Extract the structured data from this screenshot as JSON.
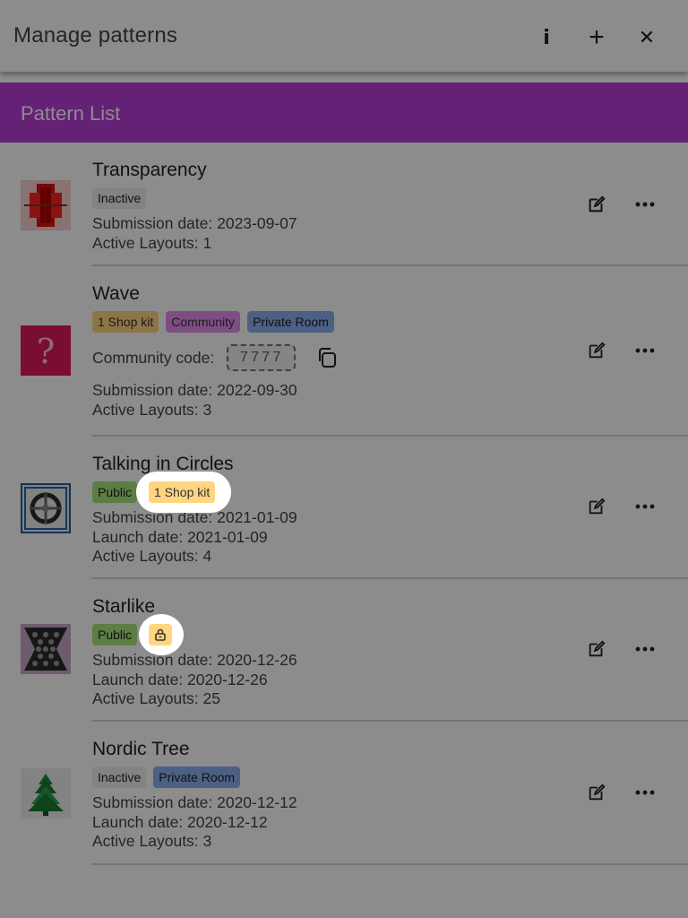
{
  "header": {
    "title": "Manage patterns",
    "actions": {
      "info_label": "i",
      "add_label": "+",
      "close_label": "✕"
    }
  },
  "section": {
    "title": "Pattern List"
  },
  "patterns": [
    {
      "name": "Transparency",
      "tags": [
        "Inactive"
      ],
      "submission": "Submission date: 2023-09-07",
      "layouts": "Active Layouts: 1"
    },
    {
      "name": "Wave",
      "tags": [
        "1 Shop kit",
        "Community",
        "Private Room"
      ],
      "community_label": "Community code:",
      "community_code": "7777",
      "submission": "Submission date: 2022-09-30",
      "layouts": "Active Layouts: 3"
    },
    {
      "name": "Talking in Circles",
      "tags": [
        "Public",
        "1 Shop kit"
      ],
      "submission": "Submission date: 2021-01-09",
      "launch": "Launch date: 2021-01-09",
      "layouts": "Active Layouts: 4"
    },
    {
      "name": "Starlike",
      "tags": [
        "Public"
      ],
      "submission": "Submission date: 2020-12-26",
      "launch": "Launch date: 2020-12-26",
      "layouts": "Active Layouts: 25"
    },
    {
      "name": "Nordic Tree",
      "tags": [
        "Inactive",
        "Private Room"
      ],
      "submission": "Submission date: 2020-12-12",
      "launch": "Launch date: 2020-12-12",
      "layouts": "Active Layouts: 3"
    }
  ],
  "icons": {
    "thumb_transparency": "red-lattice-thumbnail",
    "thumb_wave": "question-mark-placeholder",
    "thumb_circles": "circle-cross-thumbnail",
    "thumb_starlike": "hexagon-grid-thumbnail",
    "thumb_nordic": "christmas-tree-thumbnail",
    "edit": "edit-icon",
    "more": "more-horizontal-icon",
    "copy": "copy-icon",
    "lock": "lock-icon"
  },
  "colors": {
    "accent": "#b93dd8",
    "tag_inactive": "#eeeeee",
    "tag_shop": "#ffd580",
    "tag_community": "#e68cf0",
    "tag_private": "#8ab0f0",
    "tag_public": "#a6e67a"
  }
}
